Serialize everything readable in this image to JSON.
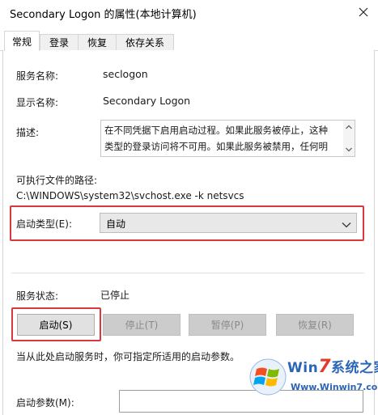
{
  "window": {
    "title": "Secondary Logon 的属性(本地计算机)"
  },
  "tabs": [
    {
      "label": "常规",
      "active": true
    },
    {
      "label": "登录",
      "active": false
    },
    {
      "label": "恢复",
      "active": false
    },
    {
      "label": "依存关系",
      "active": false
    }
  ],
  "general": {
    "service_name_label": "服务名称:",
    "service_name": "seclogon",
    "display_name_label": "显示名称:",
    "display_name": "Secondary Logon",
    "description_label": "描述:",
    "description_line1": "在不同凭据下启用启动过程。如果此服务被停止，这种",
    "description_line2": "类型的登录访问将不可用。如果此服务被禁用，任何明",
    "exe_path_label": "可执行文件的路径:",
    "exe_path": "C:\\WINDOWS\\system32\\svchost.exe -k netsvcs",
    "startup_type_label": "启动类型(E):",
    "startup_type_value": "自动",
    "service_status_label": "服务状态:",
    "service_status": "已停止",
    "buttons": {
      "start": "启动(S)",
      "stop": "停止(T)",
      "pause": "暂停(P)",
      "resume": "恢复(R)"
    },
    "hint": "当从此处启动服务时，你可指定所适用的启动参数。",
    "start_params_label": "启动参数(M):",
    "start_params_value": ""
  },
  "watermark": {
    "brand_prefix": "Win",
    "brand_seven": "7",
    "brand_suffix": "系统之家",
    "url": "Www.Winwin7.com"
  },
  "colors": {
    "highlight": "#d9393d",
    "watermark_blue": "#2a65b8",
    "watermark_red": "#e23b2e"
  }
}
